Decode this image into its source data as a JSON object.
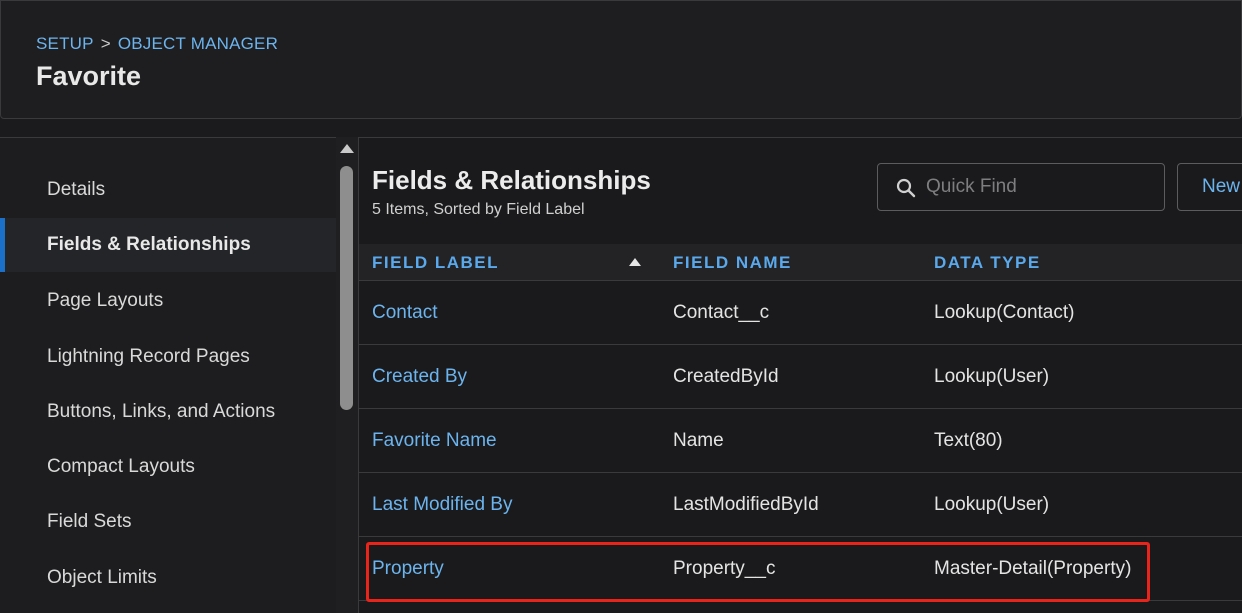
{
  "header": {
    "breadcrumb": [
      "SETUP",
      "OBJECT MANAGER"
    ],
    "breadcrumb_separator": ">",
    "title": "Favorite"
  },
  "sidebar": {
    "items": [
      {
        "label": "Details",
        "active": false
      },
      {
        "label": "Fields & Relationships",
        "active": true
      },
      {
        "label": "Page Layouts",
        "active": false
      },
      {
        "label": "Lightning Record Pages",
        "active": false
      },
      {
        "label": "Buttons, Links, and Actions",
        "active": false
      },
      {
        "label": "Compact Layouts",
        "active": false
      },
      {
        "label": "Field Sets",
        "active": false
      },
      {
        "label": "Object Limits",
        "active": false
      }
    ]
  },
  "main": {
    "title": "Fields & Relationships",
    "subtitle": "5 Items, Sorted by Field Label",
    "search": {
      "placeholder": "Quick Find",
      "value": ""
    },
    "new_button_label": "New",
    "table": {
      "columns": [
        "FIELD LABEL",
        "FIELD NAME",
        "DATA TYPE"
      ],
      "sorted_column": "FIELD LABEL",
      "sort_direction": "ascending",
      "rows": [
        {
          "label": "Contact",
          "name": "Contact__c",
          "type": "Lookup(Contact)"
        },
        {
          "label": "Created By",
          "name": "CreatedById",
          "type": "Lookup(User)"
        },
        {
          "label": "Favorite Name",
          "name": "Name",
          "type": "Text(80)"
        },
        {
          "label": "Last Modified By",
          "name": "LastModifiedById",
          "type": "Lookup(User)"
        },
        {
          "label": "Property",
          "name": "Property__c",
          "type": "Master-Detail(Property)",
          "highlighted": true
        }
      ]
    }
  },
  "colors": {
    "link": "#6cb4ee",
    "active_indicator": "#1b70c9",
    "highlight_border": "#e8241b",
    "background": "#1b1b1d"
  },
  "icons": {
    "search": "search-icon",
    "sort": "sort-ascending-icon",
    "scroll_up": "scroll-up-arrow-icon"
  }
}
